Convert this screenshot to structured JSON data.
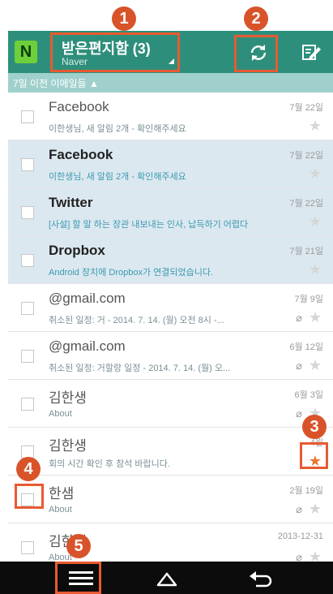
{
  "callouts": [
    "1",
    "2",
    "3",
    "4",
    "5"
  ],
  "appbar": {
    "logo_letter": "N",
    "folder_title": "받은편지함 (3)",
    "account": "Naver"
  },
  "section": {
    "label": "7일 이전 이메일들 ▲"
  },
  "emails": [
    {
      "sender": "Facebook",
      "preview": "이한생님, 새 알림 2개 - 확인해주세요",
      "date": "7월 22일",
      "unread": false,
      "starred": false,
      "attachment": false
    },
    {
      "sender": "Facebook",
      "preview": "이한생님, 새 알림 2개 - 확인해주세요",
      "date": "7월 22일",
      "unread": true,
      "starred": false,
      "attachment": false
    },
    {
      "sender": "Twitter",
      "preview": "[사설] 할 말 하는 장관 내보내는 인사, 납득하기 어렵다",
      "date": "7월 22일",
      "unread": true,
      "starred": false,
      "attachment": false
    },
    {
      "sender": "Dropbox",
      "preview": "Android 장치에 Dropbox가 연결되었습니다.",
      "date": "7월 21일",
      "unread": true,
      "starred": false,
      "attachment": false
    },
    {
      "sender": "@gmail.com",
      "preview": "취소된 일정: 거 - 2014. 7. 14. (월) 오전 8시 -...",
      "date": "7월 9일",
      "unread": false,
      "starred": false,
      "attachment": true
    },
    {
      "sender": "@gmail.com",
      "preview": "취소된 일정: 거할랑 일정 - 2014. 7. 14. (월) 오...",
      "date": "6월 12일",
      "unread": false,
      "starred": false,
      "attachment": true
    },
    {
      "sender": "김한생",
      "preview": "About",
      "date": "6월 3일",
      "unread": false,
      "starred": false,
      "attachment": true
    },
    {
      "sender": "김한생",
      "preview": "회의 시간 확인 후 참석 바랍니다.",
      "date": "4월",
      "unread": false,
      "starred": true,
      "attachment": false
    },
    {
      "sender": "한샘",
      "preview": "About",
      "date": "2월 19일",
      "unread": false,
      "starred": false,
      "attachment": true
    },
    {
      "sender": "김한생",
      "preview": "About",
      "date": "2013-12-31",
      "unread": false,
      "starred": false,
      "attachment": true
    }
  ],
  "colors": {
    "accent": "#2d8f7b",
    "callout": "#d9532a",
    "star_on": "#e8772d"
  },
  "icons": {
    "refresh": "refresh-icon",
    "compose": "compose-icon",
    "menu": "menu-icon",
    "home": "home-icon",
    "back": "back-icon"
  }
}
